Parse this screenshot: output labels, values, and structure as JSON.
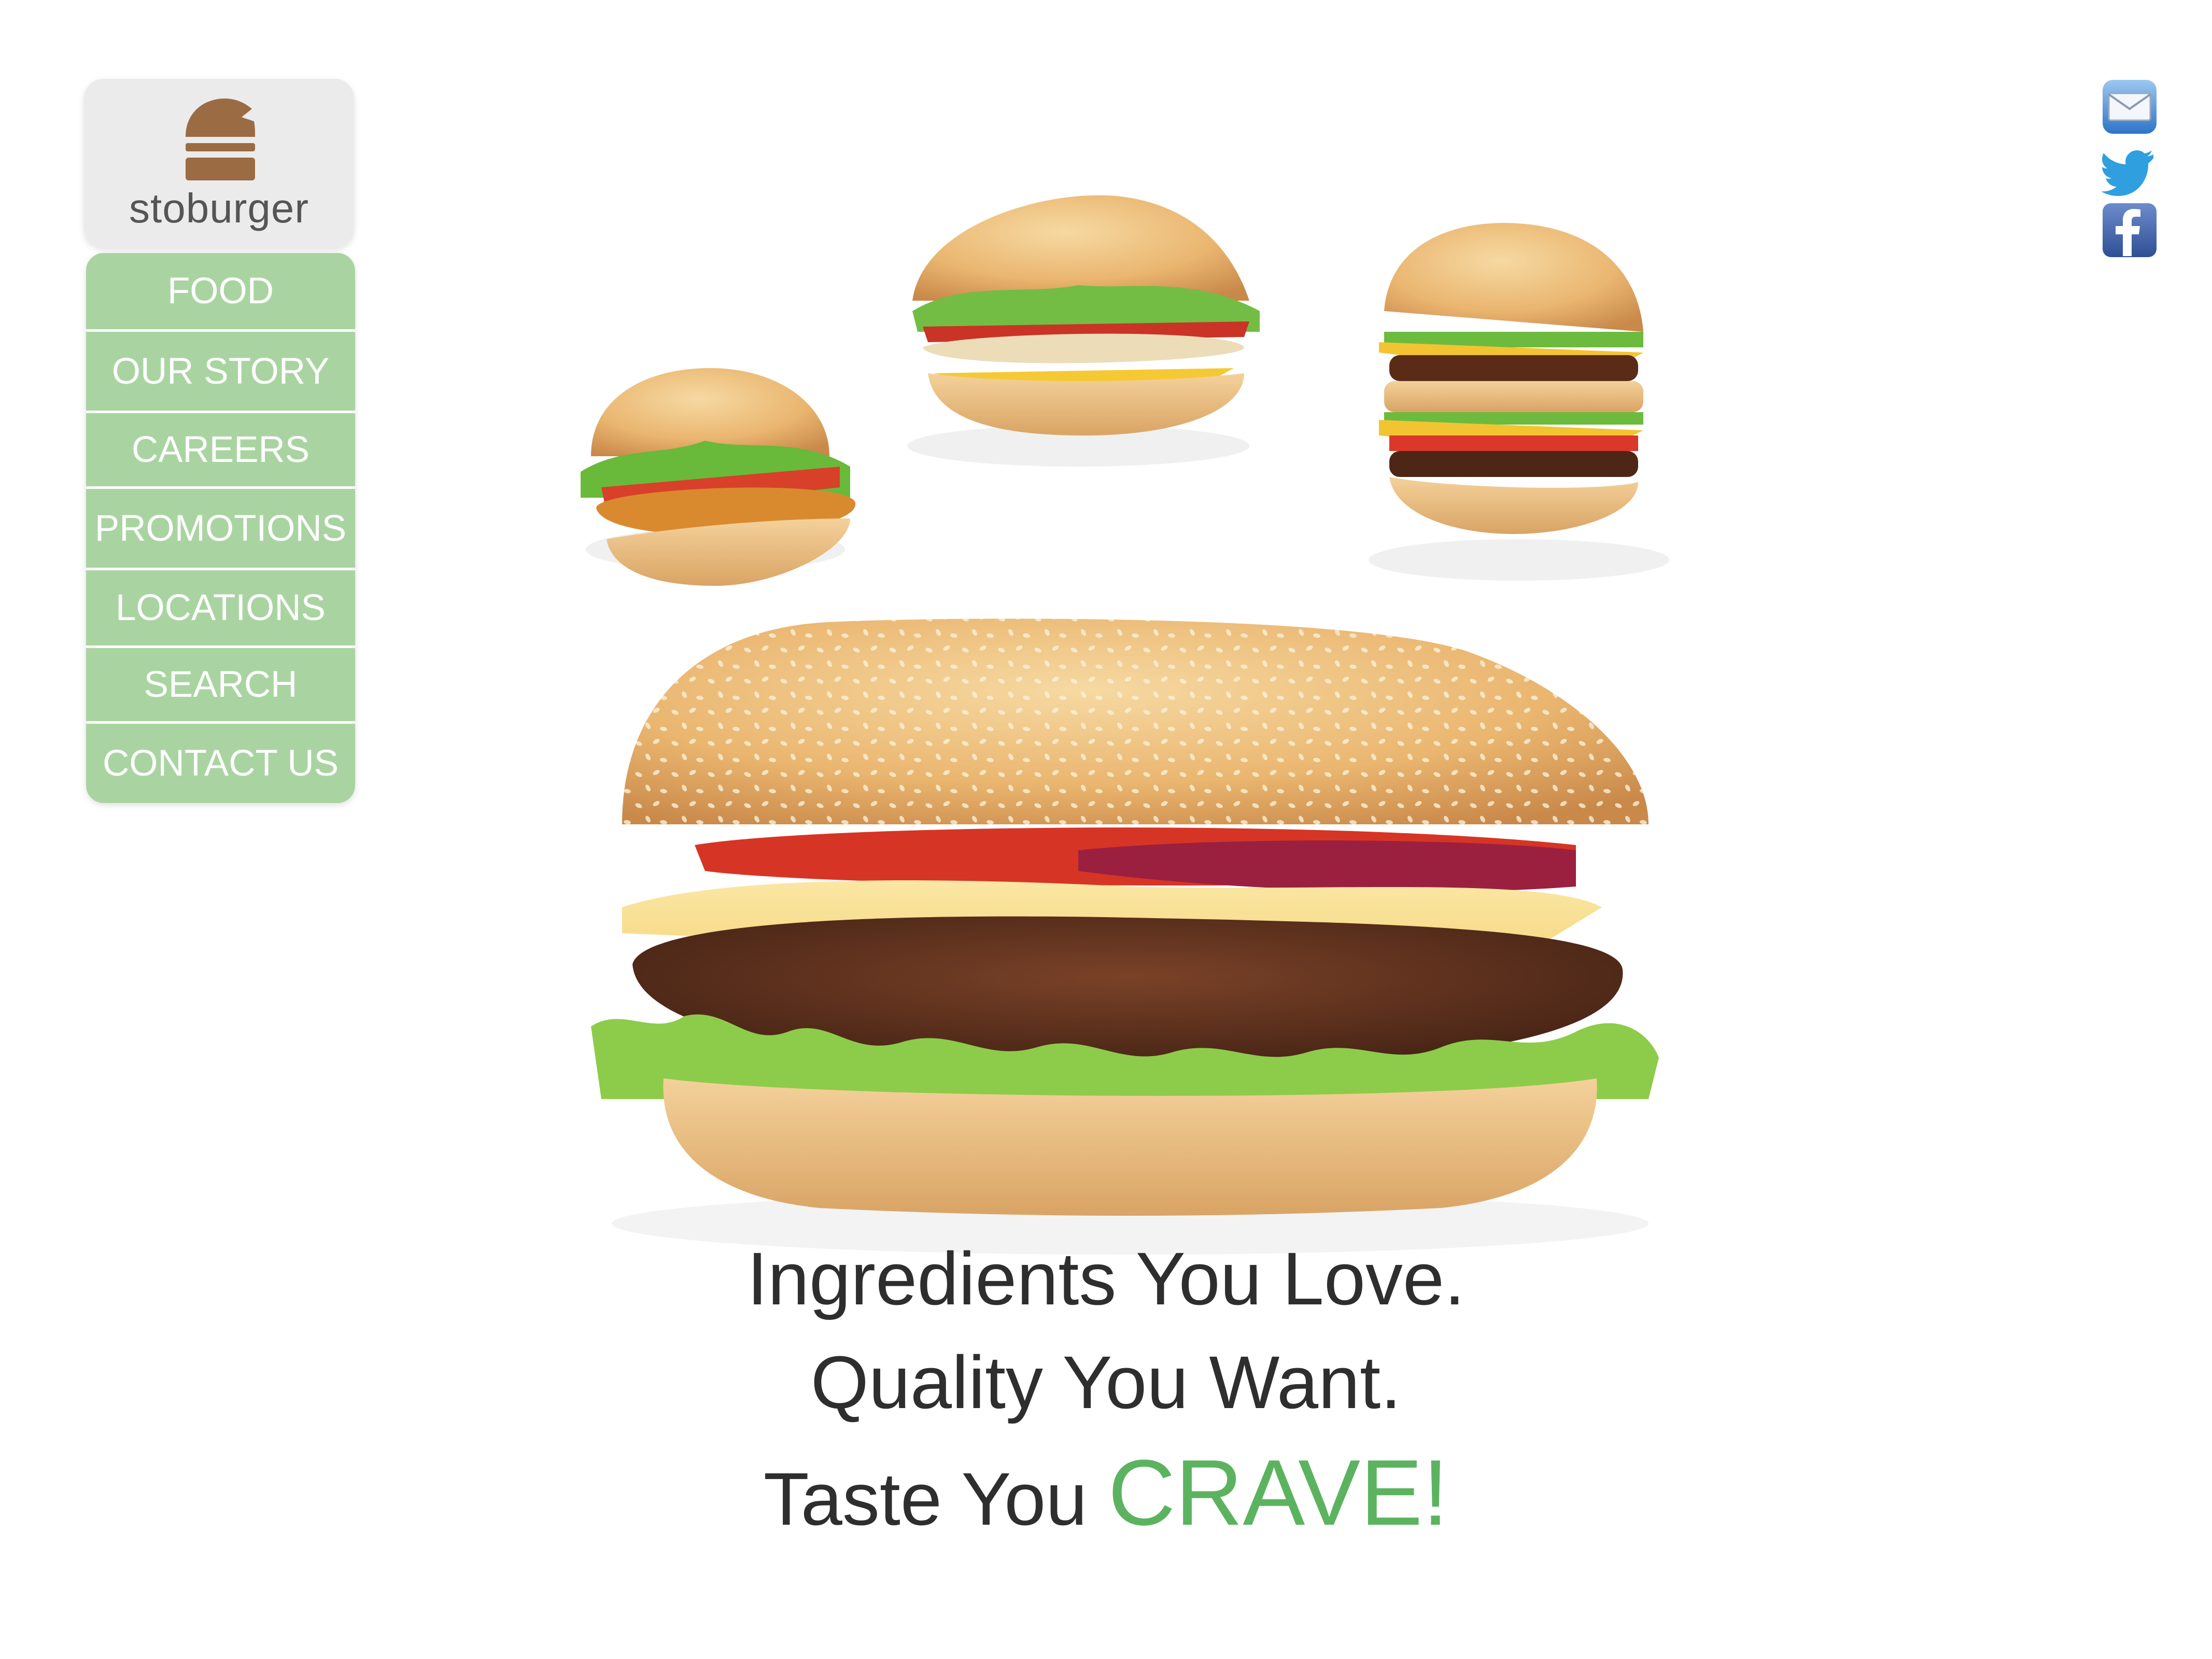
{
  "brand": {
    "name": "stoburger"
  },
  "nav": {
    "items": [
      {
        "label": "FOOD"
      },
      {
        "label": "OUR STORY"
      },
      {
        "label": "CAREERS"
      },
      {
        "label": "PROMOTIONS"
      },
      {
        "label": "LOCATIONS"
      },
      {
        "label": "SEARCH"
      },
      {
        "label": "CONTACT US"
      }
    ]
  },
  "social": {
    "icons": [
      "mail-icon",
      "twitter-icon",
      "facebook-icon"
    ]
  },
  "hero": {
    "images": [
      "crispy-chicken-burger",
      "grilled-chicken-sandwich",
      "double-cheeseburger",
      "sesame-cheeseburger"
    ]
  },
  "tagline": {
    "line1": "Ingredients You Love.",
    "line2": "Quality You Want.",
    "line3_prefix": "Taste You ",
    "line3_highlight": "CRAVE!"
  },
  "colors": {
    "nav_green": "#a9d4a1",
    "accent_green": "#5cb35f",
    "logo_brown": "#9b6b43",
    "text_dark": "#2e2e2e"
  }
}
